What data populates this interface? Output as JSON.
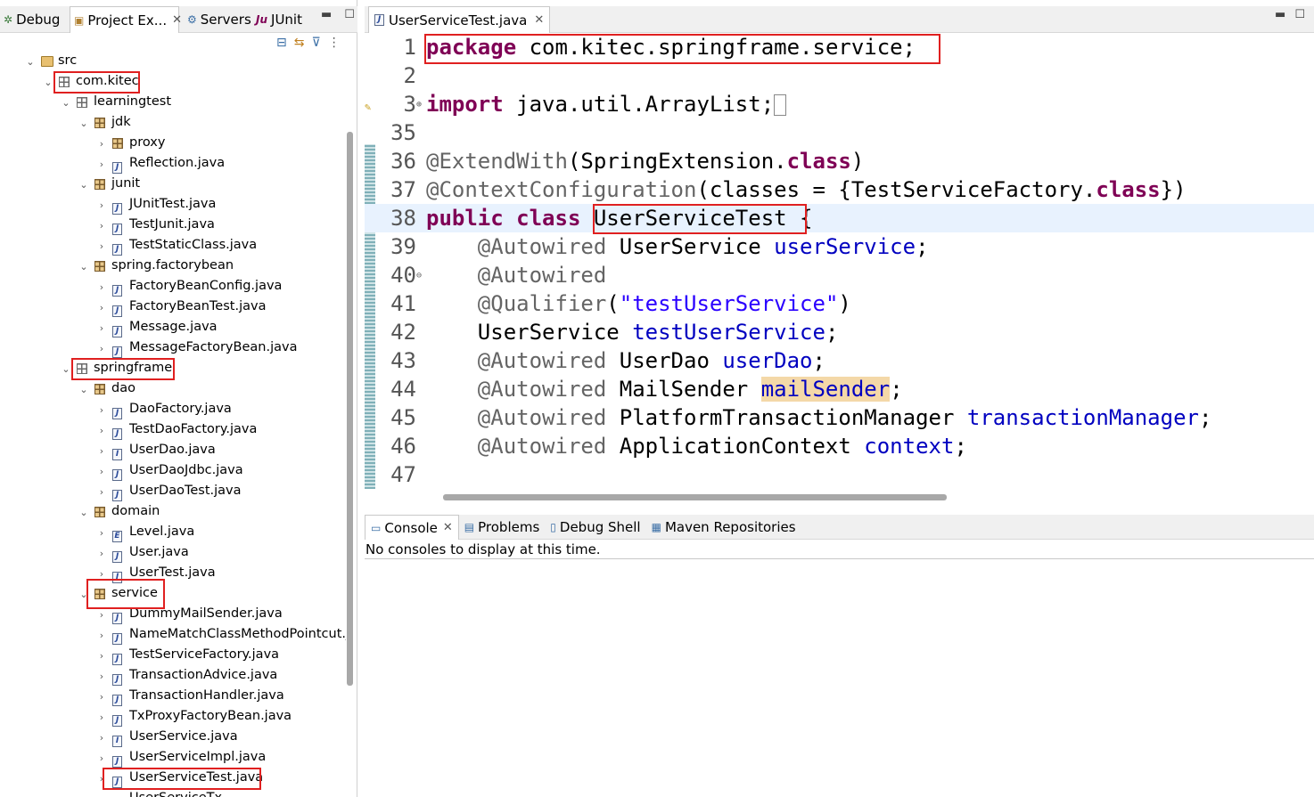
{
  "left_tabs": [
    {
      "label": "Debug",
      "icon": "debug-icon",
      "glyph": "✲"
    },
    {
      "label": "Project Ex...",
      "icon": "project-explorer-icon",
      "glyph": "▣"
    },
    {
      "label": "Servers",
      "icon": "servers-icon",
      "glyph": "⚙"
    },
    {
      "label": "JUnit",
      "icon": "junit-icon",
      "glyph": "Ju"
    }
  ],
  "tree": [
    {
      "label": "src",
      "depth": 0,
      "open": "true",
      "icon": "src"
    },
    {
      "label": "com.kitec",
      "depth": 1,
      "open": "true",
      "icon": "pkgplain"
    },
    {
      "label": "learningtest",
      "depth": 2,
      "open": "true",
      "icon": "pkgplain"
    },
    {
      "label": "jdk",
      "depth": 3,
      "open": "true",
      "icon": "pkg"
    },
    {
      "label": "proxy",
      "depth": 4,
      "open": "false",
      "icon": "pkg"
    },
    {
      "label": "Reflection.java",
      "depth": 4,
      "open": "false",
      "icon": "java"
    },
    {
      "label": "junit",
      "depth": 3,
      "open": "true",
      "icon": "pkg"
    },
    {
      "label": "JUnitTest.java",
      "depth": 4,
      "open": "false",
      "icon": "java"
    },
    {
      "label": "TestJunit.java",
      "depth": 4,
      "open": "false",
      "icon": "java"
    },
    {
      "label": "TestStaticClass.java",
      "depth": 4,
      "open": "false",
      "icon": "java"
    },
    {
      "label": "spring.factorybean",
      "depth": 3,
      "open": "true",
      "icon": "pkg"
    },
    {
      "label": "FactoryBeanConfig.java",
      "depth": 4,
      "open": "false",
      "icon": "java"
    },
    {
      "label": "FactoryBeanTest.java",
      "depth": 4,
      "open": "false",
      "icon": "java"
    },
    {
      "label": "Message.java",
      "depth": 4,
      "open": "false",
      "icon": "java"
    },
    {
      "label": "MessageFactoryBean.java",
      "depth": 4,
      "open": "false",
      "icon": "java"
    },
    {
      "label": "springframe",
      "depth": 2,
      "open": "true",
      "icon": "pkgplain"
    },
    {
      "label": "dao",
      "depth": 3,
      "open": "true",
      "icon": "pkg"
    },
    {
      "label": "DaoFactory.java",
      "depth": 4,
      "open": "false",
      "icon": "java"
    },
    {
      "label": "TestDaoFactory.java",
      "depth": 4,
      "open": "false",
      "icon": "java"
    },
    {
      "label": "UserDao.java",
      "depth": 4,
      "open": "false",
      "icon": "javaI"
    },
    {
      "label": "UserDaoJdbc.java",
      "depth": 4,
      "open": "false",
      "icon": "java"
    },
    {
      "label": "UserDaoTest.java",
      "depth": 4,
      "open": "false",
      "icon": "java"
    },
    {
      "label": "domain",
      "depth": 3,
      "open": "true",
      "icon": "pkg"
    },
    {
      "label": "Level.java",
      "depth": 4,
      "open": "false",
      "icon": "javaE"
    },
    {
      "label": "User.java",
      "depth": 4,
      "open": "false",
      "icon": "java"
    },
    {
      "label": "UserTest.java",
      "depth": 4,
      "open": "false",
      "icon": "java"
    },
    {
      "label": "service",
      "depth": 3,
      "open": "true",
      "icon": "pkg"
    },
    {
      "label": "DummyMailSender.java",
      "depth": 4,
      "open": "false",
      "icon": "java"
    },
    {
      "label": "NameMatchClassMethodPointcut.ja",
      "depth": 4,
      "open": "false",
      "icon": "java"
    },
    {
      "label": "TestServiceFactory.java",
      "depth": 4,
      "open": "false",
      "icon": "java"
    },
    {
      "label": "TransactionAdvice.java",
      "depth": 4,
      "open": "false",
      "icon": "java"
    },
    {
      "label": "TransactionHandler.java",
      "depth": 4,
      "open": "false",
      "icon": "java"
    },
    {
      "label": "TxProxyFactoryBean.java",
      "depth": 4,
      "open": "false",
      "icon": "java"
    },
    {
      "label": "UserService.java",
      "depth": 4,
      "open": "false",
      "icon": "javaI"
    },
    {
      "label": "UserServiceImpl.java",
      "depth": 4,
      "open": "false",
      "icon": "java"
    },
    {
      "label": "UserServiceTest.java",
      "depth": 4,
      "open": "false",
      "icon": "java"
    },
    {
      "label": "UserServiceTx",
      "depth": 4,
      "open": "false",
      "icon": "java"
    }
  ],
  "editor": {
    "tab_label": "UserServiceTest.java",
    "lines": [
      {
        "n": "1",
        "html": "<span class=\"kw\">package</span> com.kitec.springframe.service;"
      },
      {
        "n": "2",
        "html": ""
      },
      {
        "n": "3",
        "html": "<span class=\"kw\">import</span> java.util.ArrayList;<span class=\"sbox\"></span>"
      },
      {
        "n": "35",
        "html": ""
      },
      {
        "n": "36",
        "html": "<span class=\"an\">@ExtendWith</span>(SpringExtension.<span class=\"kw\">class</span>)"
      },
      {
        "n": "37",
        "html": "<span class=\"an\">@ContextConfiguration</span>(classes = {TestServiceFactory.<span class=\"kw\">class</span>})"
      },
      {
        "n": "38",
        "html": "<span class=\"kw\">public</span> <span class=\"kw\">class</span> UserServiceTest {"
      },
      {
        "n": "39",
        "html": "    <span class=\"an\">@Autowired</span> UserService <span class=\"fd\">userService</span>;"
      },
      {
        "n": "40",
        "html": "    <span class=\"an\">@Autowired</span>"
      },
      {
        "n": "41",
        "html": "    <span class=\"an\">@Qualifier</span>(<span class=\"st\">\"testUserService\"</span>)"
      },
      {
        "n": "42",
        "html": "    UserService <span class=\"fd\">testUserService</span>;"
      },
      {
        "n": "43",
        "html": "    <span class=\"an\">@Autowired</span> UserDao <span class=\"fd\">userDao</span>;"
      },
      {
        "n": "44",
        "html": "    <span class=\"an\">@Autowired</span> MailSender <span class=\"fd occ\">mailSender</span>;"
      },
      {
        "n": "45",
        "html": "    <span class=\"an\">@Autowired</span> PlatformTransactionManager <span class=\"fd\">transactionManager</span>;"
      },
      {
        "n": "46",
        "html": "    <span class=\"an\">@Autowired</span> ApplicationContext <span class=\"fd\">context</span>;"
      },
      {
        "n": "47",
        "html": ""
      }
    ]
  },
  "console": {
    "tabs": [
      {
        "label": "Console",
        "icon": "console-icon",
        "glyph": "▭"
      },
      {
        "label": "Problems",
        "icon": "problems-icon",
        "glyph": "▤"
      },
      {
        "label": "Debug Shell",
        "icon": "debug-shell-icon",
        "glyph": "▯"
      },
      {
        "label": "Maven Repositories",
        "icon": "maven-repositories-icon",
        "glyph": "▦"
      }
    ],
    "message": "No consoles to display at this time."
  }
}
